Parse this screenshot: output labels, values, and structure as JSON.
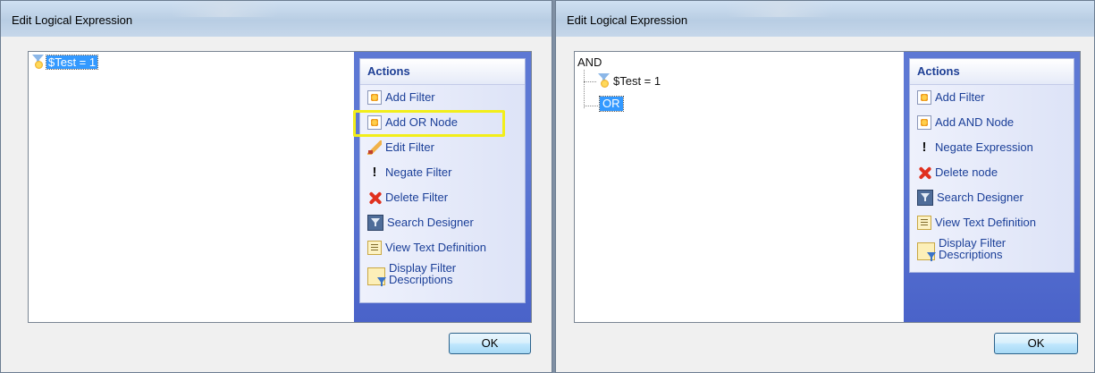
{
  "left_dialog": {
    "title": "Edit Logical Expression",
    "tree": {
      "node": "$Test = 1"
    },
    "actions_header": "Actions",
    "actions": [
      {
        "label": "Add Filter",
        "icon": "add-filter-icon"
      },
      {
        "label": "Add OR Node",
        "icon": "add-node-icon",
        "highlighted": true
      },
      {
        "label": "Edit Filter",
        "icon": "edit-icon"
      },
      {
        "label": "Negate Filter",
        "icon": "exclamation-icon"
      },
      {
        "label": "Delete Filter",
        "icon": "delete-x-icon"
      },
      {
        "label": "Search Designer",
        "icon": "search-designer-icon"
      },
      {
        "label": "View Text Definition",
        "icon": "text-definition-icon"
      },
      {
        "label": "Display Filter Descriptions",
        "icon": "filter-descriptions-icon"
      }
    ],
    "ok_label": "OK"
  },
  "right_dialog": {
    "title": "Edit Logical Expression",
    "tree": {
      "root": "AND",
      "child": "$Test = 1",
      "selected": "OR"
    },
    "actions_header": "Actions",
    "actions": [
      {
        "label": "Add Filter",
        "icon": "add-filter-icon"
      },
      {
        "label": "Add AND Node",
        "icon": "add-node-icon"
      },
      {
        "label": "Negate Expression",
        "icon": "exclamation-icon"
      },
      {
        "label": "Delete node",
        "icon": "delete-x-icon"
      },
      {
        "label": "Search Designer",
        "icon": "search-designer-icon"
      },
      {
        "label": "View Text Definition",
        "icon": "text-definition-icon"
      },
      {
        "label": "Display Filter Descriptions",
        "icon": "filter-descriptions-icon"
      }
    ],
    "ok_label": "OK"
  },
  "colors": {
    "selection": "#3399ff",
    "highlight_box": "#f2ee1a",
    "actions_pane": "#5d78d4",
    "action_text": "#1b3f98"
  }
}
